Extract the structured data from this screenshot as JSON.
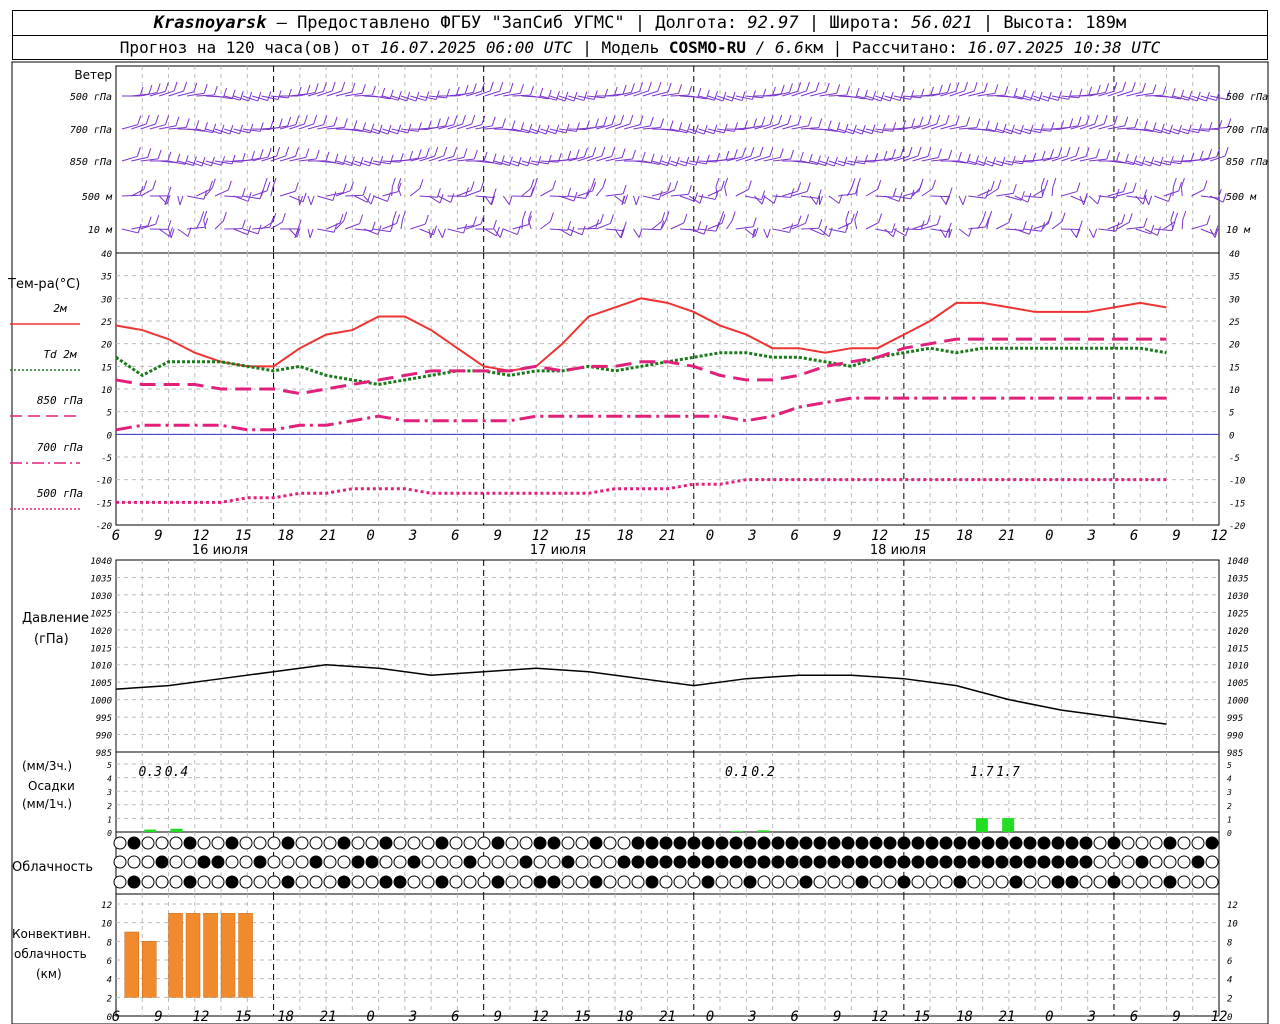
{
  "header": {
    "line1": {
      "place": "Krasnoyarsk",
      "provider": "– Предоставлено ФГБУ \"ЗапСиб УГМС\" | Долгота:",
      "lon": "92.97",
      "lat_label": "| Широта:",
      "lat": "56.021",
      "alt_label": "| Высота:",
      "alt": "189",
      "alt_unit": "м"
    },
    "line2": {
      "forecast_label": "Прогноз на 120 часа(ов) от",
      "forecast_time": "16.07.2025 06:00 UTC",
      "model_label": "| Модель",
      "model": "COSMO-RU",
      "res": "/ 6.6",
      "res_unit": "км",
      "calc_label": "| Рассчитано:",
      "calc_time": "16.07.2025 10:38 UTC"
    }
  },
  "wind_panel": {
    "title": "Ветер",
    "levels": [
      "500 гПа",
      "700 гПа",
      "850 гПа",
      "500 м",
      "10  м"
    ],
    "color": "#7a33cc"
  },
  "temp_panel": {
    "title": "Тем-ра(°C)",
    "legend": [
      {
        "label": "2м",
        "color": "#ee3333",
        "style": "solid"
      },
      {
        "label": "Td  2м",
        "color": "#1a7a1a",
        "style": "dotted"
      },
      {
        "label": "850 гПа",
        "color": "#e0207a",
        "style": "dashed"
      },
      {
        "label": "700 гПа",
        "color": "#e0207a",
        "style": "dashdot"
      },
      {
        "label": "500 гПа",
        "color": "#e0207a",
        "style": "dotted"
      }
    ]
  },
  "pressure_panel": {
    "title1": "Давление",
    "title2": "(гПа)"
  },
  "precip_panel": {
    "title1": "(мм/3ч.)",
    "title2": "Осадки",
    "title3": "(мм/1ч.)"
  },
  "cloud_panel": {
    "title": "Облачность"
  },
  "conv_panel": {
    "title1": "Конвективн.",
    "title2": "облачность",
    "title3": "(км)"
  },
  "x_axis": {
    "tick_labels": [
      "6",
      "9",
      "12",
      "15",
      "18",
      "21",
      "0",
      "3",
      "6",
      "9",
      "12",
      "15",
      "18",
      "21",
      "0",
      "3",
      "6",
      "9",
      "12",
      "15",
      "18",
      "21",
      "0",
      "3",
      "6",
      "9",
      "12"
    ],
    "day_labels": [
      "16 июля",
      "17 июля",
      "18 июля"
    ]
  },
  "colors": {
    "t2m": "#ee3333",
    "td2m": "#1a7a1a",
    "upper": "#e0207a",
    "pressure": "#000000",
    "precip": "#22dd22",
    "conv": "#f08a2c",
    "wind": "#7a33cc",
    "zero_line": "#3333cc"
  },
  "chart_data": [
    {
      "type": "line",
      "title": "Тем-ра(°C)",
      "x_hours_from_start": [
        0,
        3,
        6,
        9,
        12,
        15,
        18,
        21,
        24,
        27,
        30,
        33,
        36,
        39,
        42,
        45,
        48,
        51,
        54,
        57,
        60,
        63,
        66,
        69,
        72,
        75,
        78,
        81,
        84,
        87,
        90,
        93,
        96,
        99,
        102,
        105,
        108,
        111,
        114,
        117,
        120
      ],
      "ylim": [
        -20,
        40
      ],
      "series": [
        {
          "name": "2м",
          "values": [
            24,
            23,
            21,
            18,
            16,
            15,
            15,
            19,
            22,
            23,
            26,
            26,
            23,
            19,
            15,
            14,
            15,
            20,
            26,
            28,
            30,
            29,
            27,
            24,
            22,
            19,
            19,
            18,
            19,
            19,
            22,
            25,
            29,
            29,
            28,
            27,
            27,
            27,
            28,
            29,
            28
          ]
        },
        {
          "name": "Td  2м",
          "values": [
            17,
            13,
            16,
            16,
            16,
            15,
            14,
            15,
            13,
            12,
            11,
            12,
            13,
            14,
            14,
            13,
            14,
            14,
            15,
            14,
            15,
            16,
            17,
            18,
            18,
            17,
            17,
            16,
            15,
            17,
            18,
            19,
            18,
            19,
            19,
            19,
            19,
            19,
            19,
            19,
            18
          ]
        },
        {
          "name": "850 гПа",
          "values": [
            12,
            11,
            11,
            11,
            10,
            10,
            10,
            9,
            10,
            11,
            12,
            13,
            14,
            14,
            14,
            14,
            15,
            14,
            15,
            15,
            16,
            16,
            15,
            13,
            12,
            12,
            13,
            15,
            16,
            17,
            19,
            20,
            21,
            21,
            21,
            21,
            21,
            21,
            21,
            21,
            21
          ]
        },
        {
          "name": "700 гПа",
          "values": [
            1,
            2,
            2,
            2,
            2,
            1,
            1,
            2,
            2,
            3,
            4,
            3,
            3,
            3,
            3,
            3,
            4,
            4,
            4,
            4,
            4,
            4,
            4,
            4,
            3,
            4,
            6,
            7,
            8,
            8,
            8,
            8,
            8,
            8,
            8,
            8,
            8,
            8,
            8,
            8,
            8
          ]
        },
        {
          "name": "500 гПа",
          "values": [
            -15,
            -15,
            -15,
            -15,
            -15,
            -14,
            -14,
            -13,
            -13,
            -12,
            -12,
            -12,
            -13,
            -13,
            -13,
            -13,
            -13,
            -13,
            -13,
            -12,
            -12,
            -12,
            -11,
            -11,
            -10,
            -10,
            -10,
            -10,
            -10,
            -10,
            -10,
            -10,
            -10,
            -10,
            -10,
            -10,
            -10,
            -10,
            -10,
            -10,
            -10
          ]
        }
      ]
    },
    {
      "type": "line",
      "title": "Давление",
      "ylabel": "(гПа)",
      "x_hours_from_start": [
        0,
        6,
        12,
        18,
        24,
        30,
        36,
        42,
        48,
        54,
        60,
        66,
        72,
        78,
        84,
        90,
        96,
        102,
        108,
        114,
        120
      ],
      "ylim": [
        985,
        1040
      ],
      "series": [
        {
          "name": "",
          "values": [
            1003,
            1004,
            1006,
            1008,
            1010,
            1009,
            1007,
            1008,
            1009,
            1008,
            1006,
            1004,
            1006,
            1007,
            1007,
            1006,
            1004,
            1000,
            997,
            995,
            993
          ]
        }
      ]
    },
    {
      "type": "bar",
      "title": "Осадки",
      "x_hours_from_start": [
        3,
        6,
        70,
        73,
        98,
        101
      ],
      "values": [
        0.3,
        0.4,
        0.1,
        0.2,
        1.7,
        1.7
      ],
      "ylim": [
        0,
        5
      ]
    },
    {
      "type": "bar",
      "title": "Конвективн. облачность",
      "ylabel": "(км)",
      "x_hours_from_start": [
        1,
        3,
        6,
        8,
        10,
        12,
        14
      ],
      "values": [
        9,
        8,
        11,
        11,
        11,
        11,
        11
      ],
      "ylim": [
        0,
        12
      ]
    }
  ]
}
